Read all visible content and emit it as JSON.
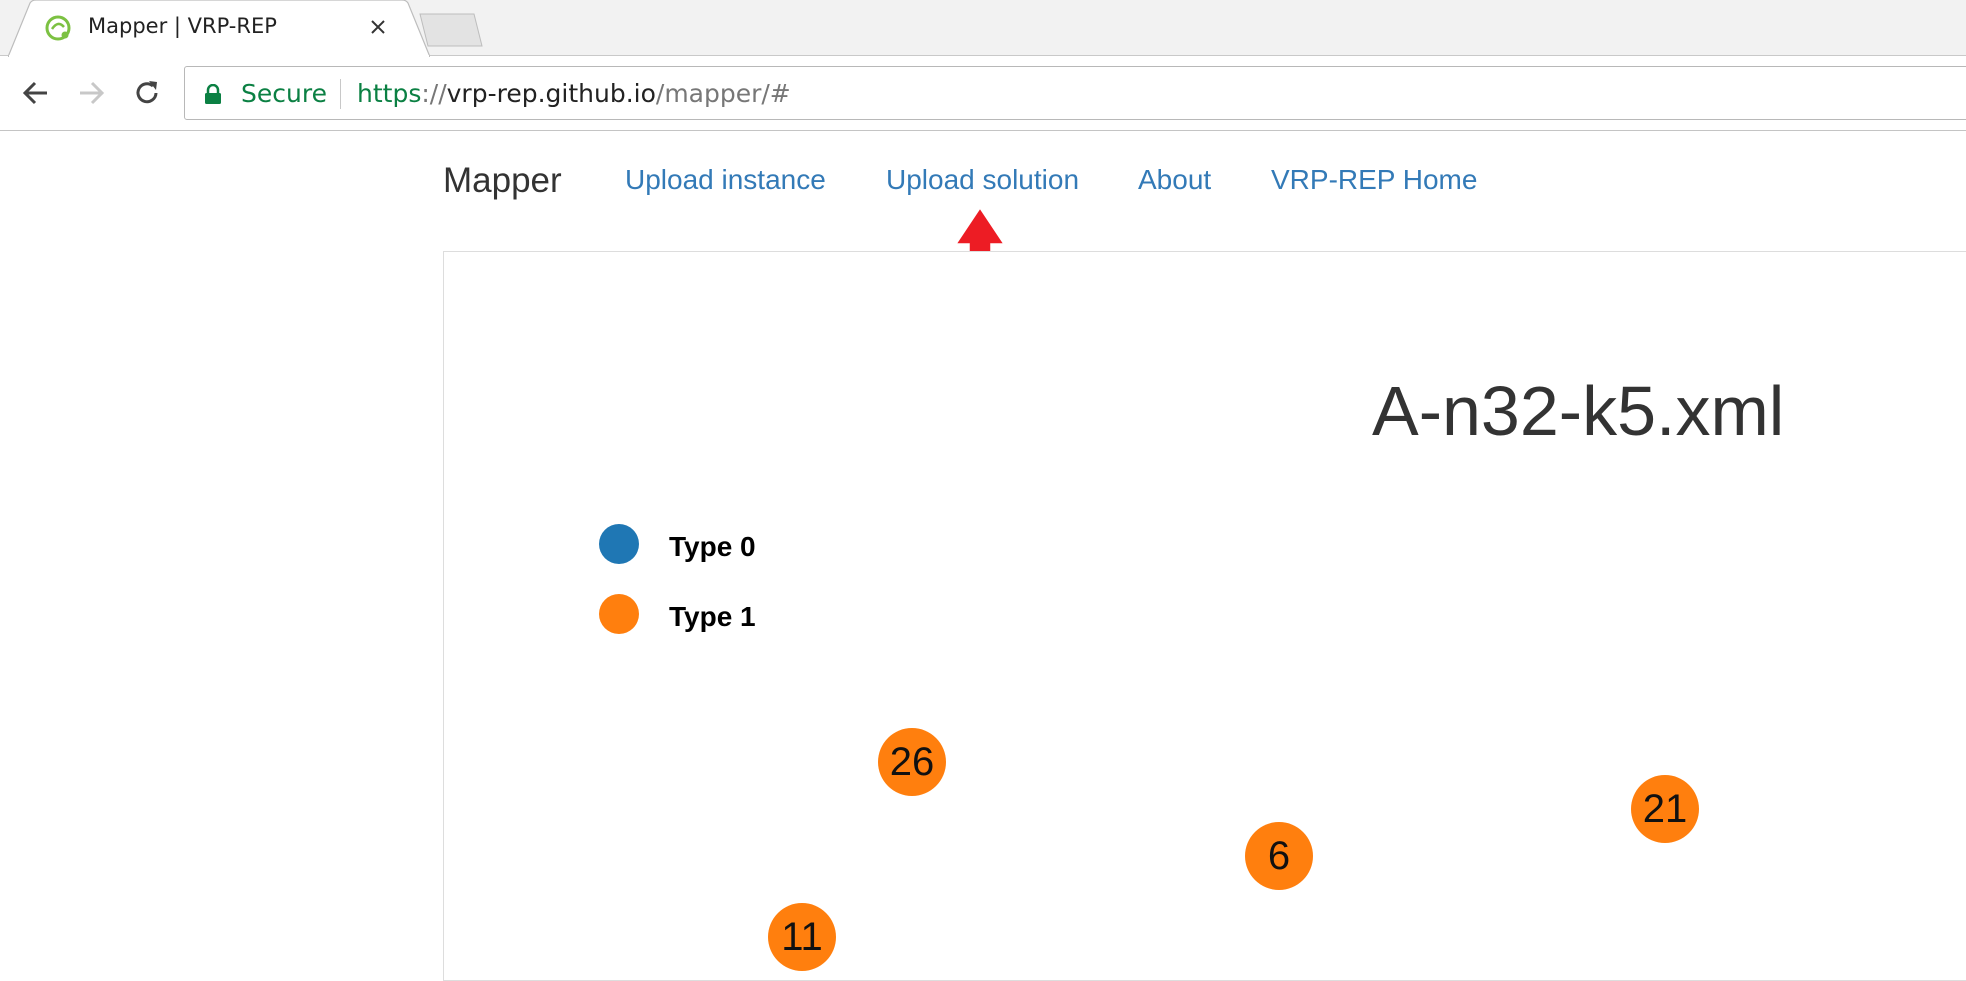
{
  "browser": {
    "tab": {
      "title": "Mapper | VRP-REP",
      "favicon": "vrp-rep-favicon-icon",
      "close_icon": "close-icon"
    },
    "omnibox": {
      "secure_label": "Secure",
      "url_scheme": "https",
      "url_sep": "://",
      "url_host": "vrp-rep.github.io",
      "url_path": "/mapper/#"
    }
  },
  "navbar": {
    "brand": "Mapper",
    "links": [
      "Upload instance",
      "Upload solution",
      "About",
      "VRP-REP Home"
    ]
  },
  "annotation": {
    "icon": "red-up-arrow-icon",
    "color": "#ed1c24"
  },
  "map": {
    "title": "A-n32-k5.xml",
    "legend": [
      {
        "label": "Type 0",
        "color": "#1f77b4"
      },
      {
        "label": "Type 1",
        "color": "#ff7f0e"
      }
    ],
    "nodes": [
      {
        "label": "26",
        "type": 1
      },
      {
        "label": "21",
        "type": 1
      },
      {
        "label": "6",
        "type": 1
      },
      {
        "label": "11",
        "type": 1
      }
    ]
  },
  "colors": {
    "link": "#337ab7",
    "secure": "#0b8043",
    "type0": "#1f77b4",
    "type1": "#ff7f0e"
  }
}
